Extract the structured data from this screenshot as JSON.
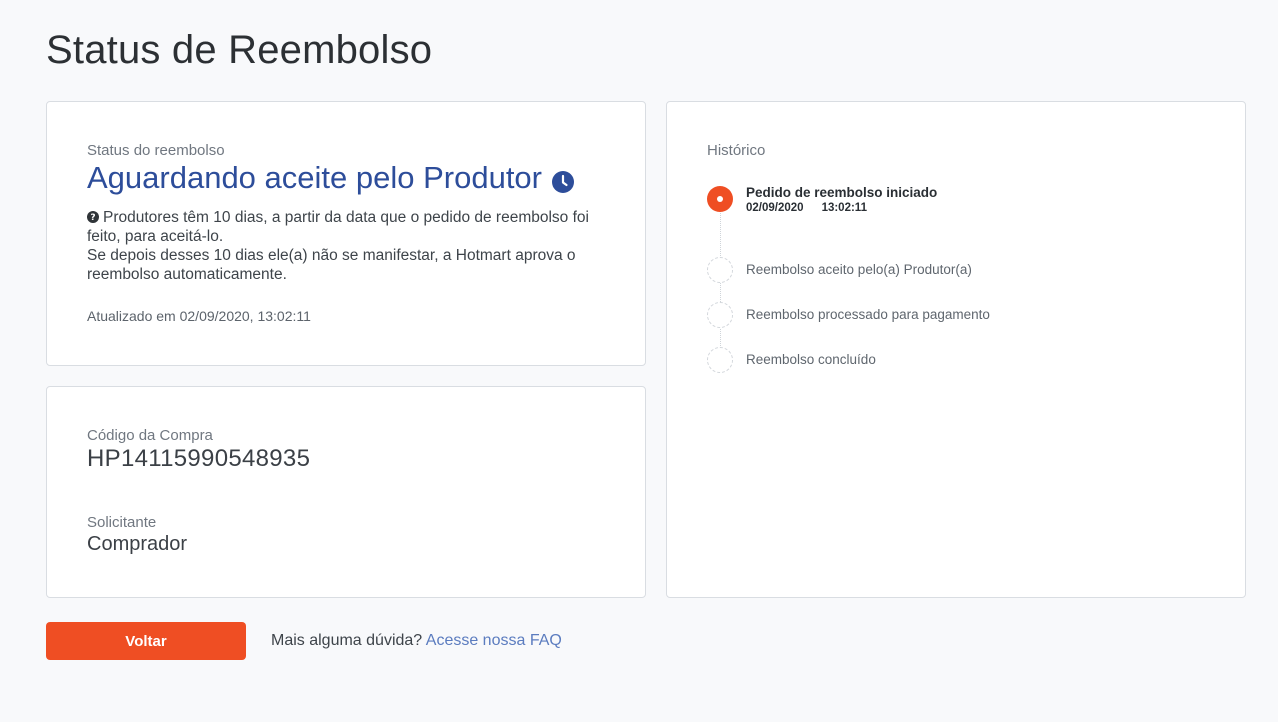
{
  "page": {
    "title": "Status de Reembolso"
  },
  "status_card": {
    "label": "Status do reembolso",
    "value": "Aguardando aceite pelo Produtor",
    "info_line1": "Produtores têm 10 dias, a partir da data que o pedido de reembolso foi feito, para aceitá-lo.",
    "info_line2": "Se depois desses 10 dias ele(a) não se manifestar, a Hotmart aprova o reembolso automaticamente.",
    "updated": "Atualizado em 02/09/2020, 13:02:11",
    "status_icon": "clock-icon",
    "info_icon": "help-icon"
  },
  "purchase_card": {
    "code_label": "Código da Compra",
    "code_value": "HP14115990548935",
    "requester_label": "Solicitante",
    "requester_value": "Comprador"
  },
  "history": {
    "label": "Histórico",
    "steps": [
      {
        "title": "Pedido de reembolso iniciado",
        "date": "02/09/2020",
        "time": "13:02:11",
        "state": "active"
      },
      {
        "title": "Reembolso aceito pelo(a) Produtor(a)",
        "state": "pending"
      },
      {
        "title": "Reembolso processado para pagamento",
        "state": "pending"
      },
      {
        "title": "Reembolso concluído",
        "state": "pending"
      }
    ]
  },
  "footer": {
    "back_label": "Voltar",
    "faq_prompt": "Mais alguma dúvida?",
    "faq_link": "Acesse nossa FAQ"
  },
  "colors": {
    "accent": "#ef4e23",
    "status_blue": "#2d4d9a",
    "link": "#5b7cbf"
  }
}
